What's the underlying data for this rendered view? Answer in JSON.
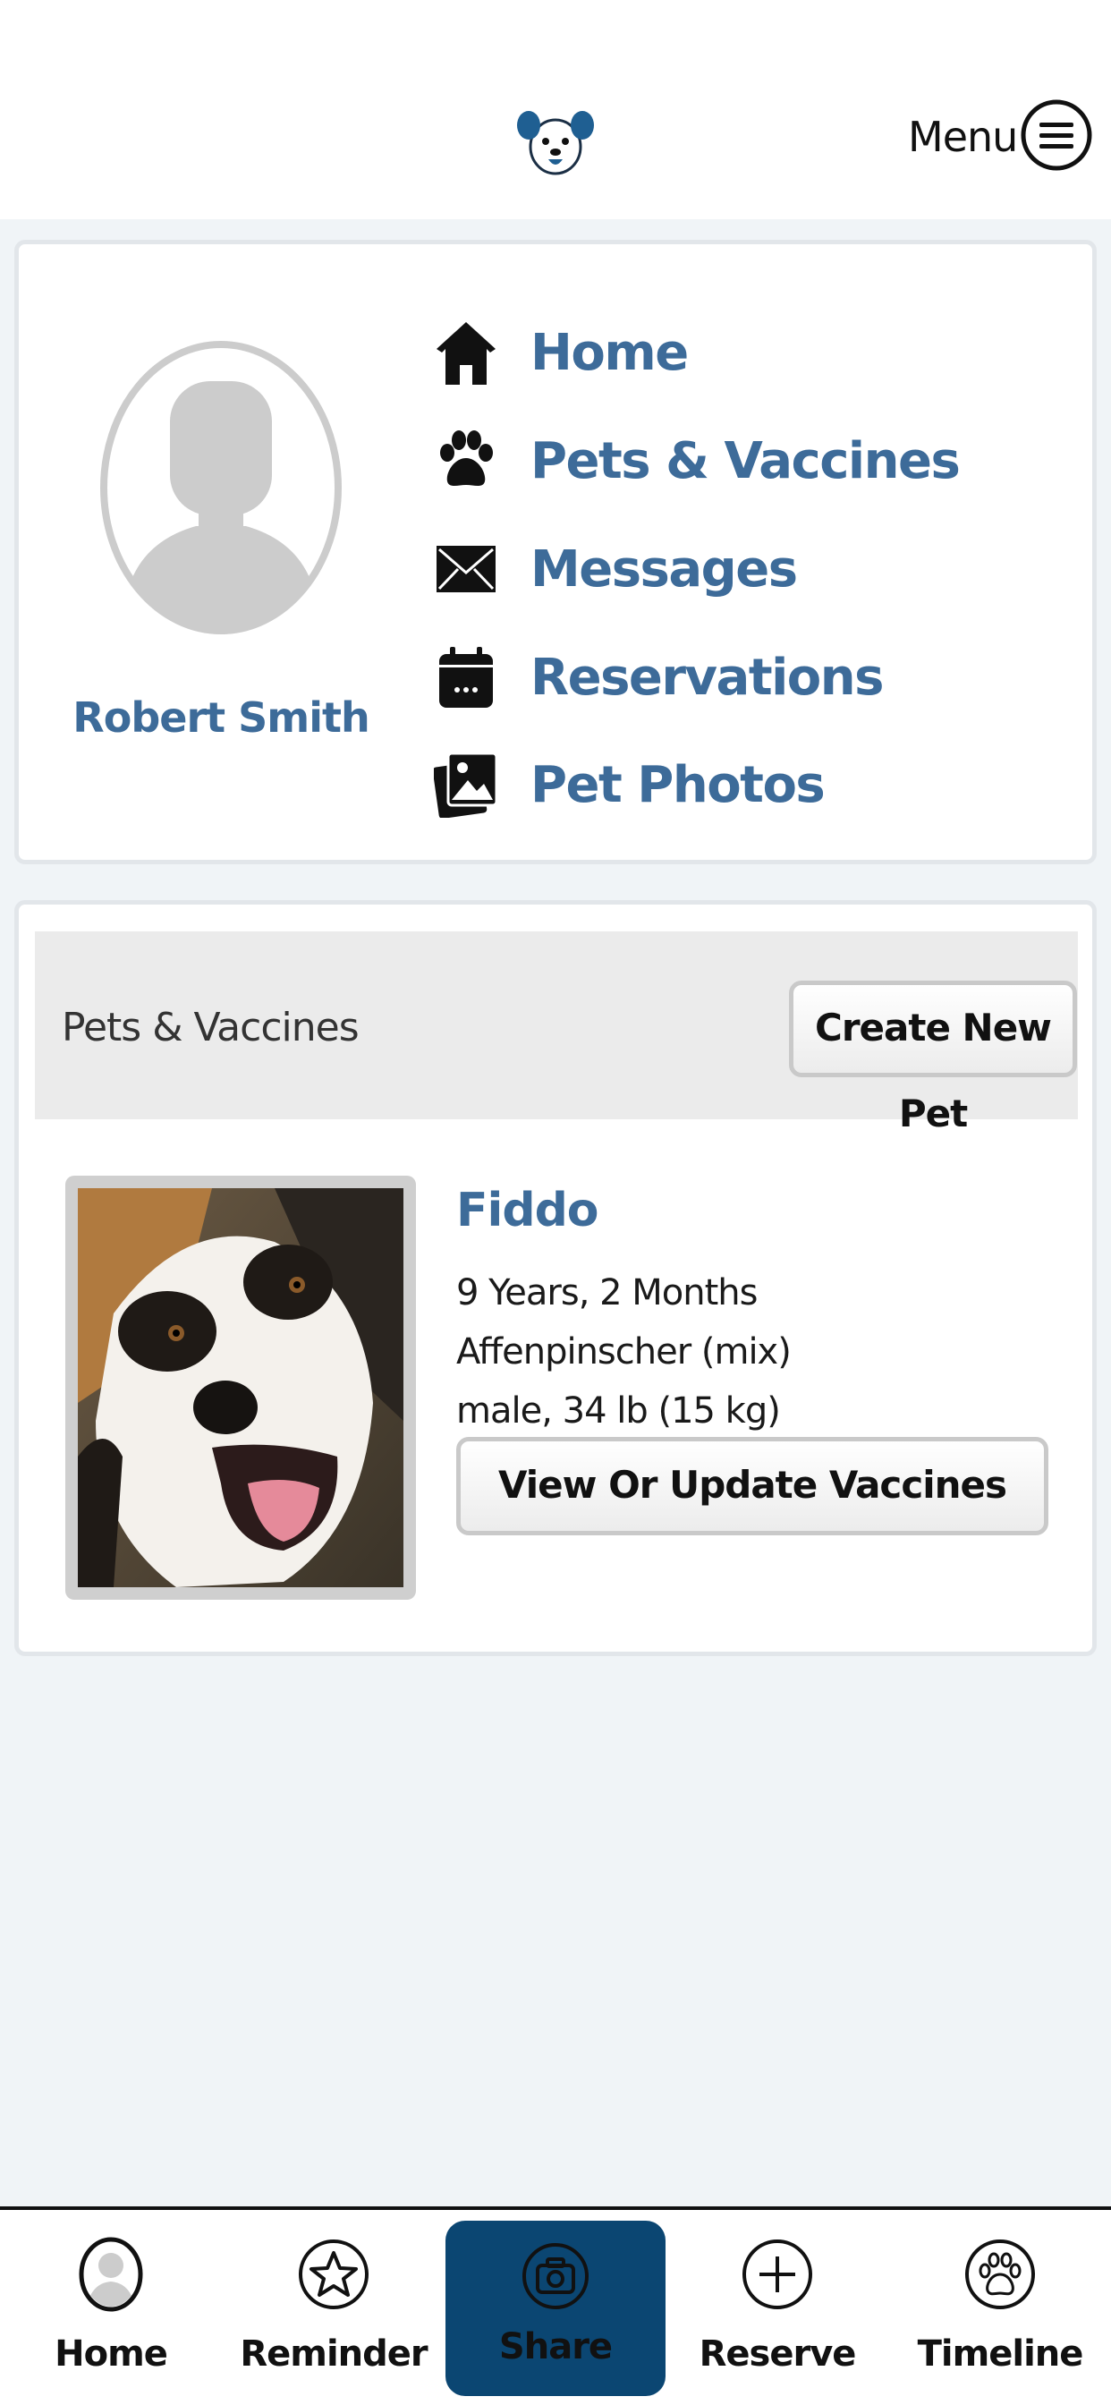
{
  "header": {
    "logo_icon": "dog-face-logo-icon",
    "menu_label": "Menu",
    "menu_icon": "hamburger-circle-icon"
  },
  "profile": {
    "avatar_icon": "person-silhouette-icon",
    "name": "Robert Smith",
    "nav": [
      {
        "label": "Home",
        "icon": "house-icon"
      },
      {
        "label": "Pets & Vaccines",
        "icon": "paw-icon"
      },
      {
        "label": "Messages",
        "icon": "envelope-icon"
      },
      {
        "label": "Reservations",
        "icon": "calendar-icon"
      },
      {
        "label": "Pet Photos",
        "icon": "photos-icon"
      }
    ]
  },
  "pets_section": {
    "title": "Pets & Vaccines",
    "create_button": "Create New Pet",
    "pets": [
      {
        "name": "Fiddo",
        "age": "9 Years, 2 Months",
        "breed": "Affenpinscher (mix)",
        "details": "male, 34 lb (15 kg)",
        "vaccines_button": "View Or Update Vaccines"
      }
    ]
  },
  "tabbar": {
    "tabs": [
      {
        "label": "Home",
        "icon": "user-avatar-icon"
      },
      {
        "label": "Reminder",
        "icon": "star-icon"
      },
      {
        "label": "Share",
        "icon": "camera-icon",
        "active": true
      },
      {
        "label": "Reserve",
        "icon": "plus-circle-icon"
      },
      {
        "label": "Timeline",
        "icon": "paw-circle-icon"
      }
    ]
  },
  "colors": {
    "accent_text": "#3d6b99",
    "share_tab_bg": "#0b4672",
    "page_bg": "#f0f4f7"
  }
}
